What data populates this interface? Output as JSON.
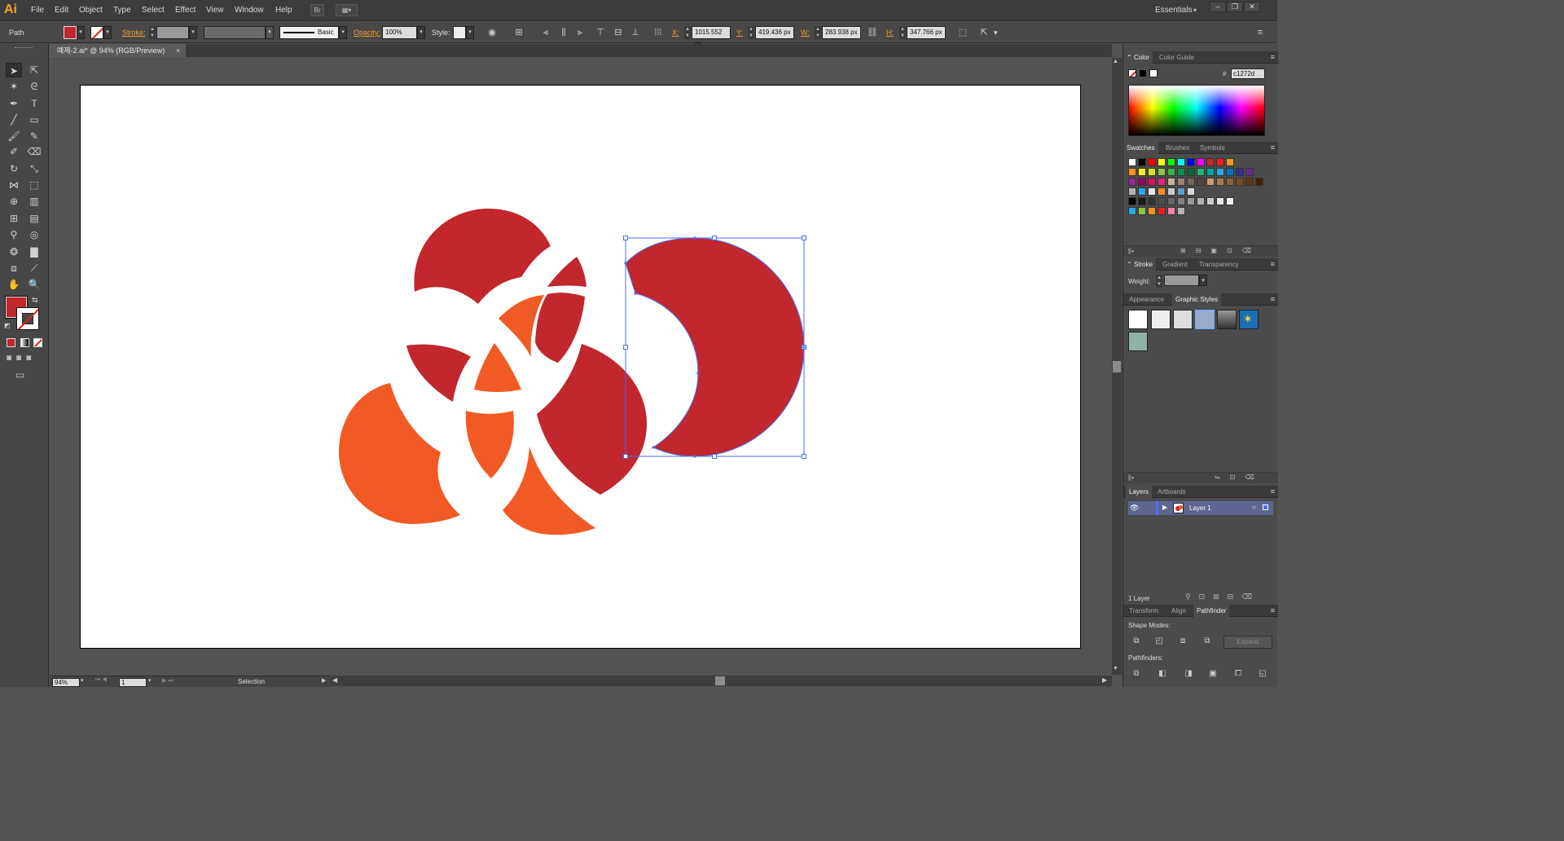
{
  "app": {
    "logo": "Ai"
  },
  "menu": [
    "File",
    "Edit",
    "Object",
    "Type",
    "Select",
    "Effect",
    "View",
    "Window",
    "Help"
  ],
  "menubar_buttons": {
    "bridge": "Br"
  },
  "workspace": "Essentials",
  "window_controls": {
    "minimize": "–",
    "restore": "❐",
    "close": "✕"
  },
  "control_bar": {
    "selection_type": "Path",
    "stroke_label": "Stroke:",
    "brush_style": "Basic",
    "opacity_label": "Opacity:",
    "opacity_value": "100%",
    "style_label": "Style:",
    "x_label": "X:",
    "x_value": "1015.552 px",
    "y_label": "Y:",
    "y_value": "419.436 px",
    "w_label": "W:",
    "w_value": "283.938 px",
    "h_label": "H:",
    "h_value": "347.766 px"
  },
  "document_tab": {
    "title": "예제-2.ai* @ 94% (RGB/Preview)",
    "close": "×"
  },
  "toolbar": {
    "tools": [
      "selection-tool",
      "direct-selection-tool",
      "magic-wand-tool",
      "lasso-tool",
      "pen-tool",
      "type-tool",
      "line-tool",
      "rectangle-tool",
      "paintbrush-tool",
      "pencil-tool",
      "blob-brush-tool",
      "eraser-tool",
      "rotate-tool",
      "scale-tool",
      "width-tool",
      "free-transform-tool",
      "shape-builder-tool",
      "perspective-grid-tool",
      "mesh-tool",
      "gradient-tool",
      "eyedropper-tool",
      "blend-tool",
      "symbol-sprayer-tool",
      "column-graph-tool",
      "artboard-tool",
      "slice-tool",
      "hand-tool",
      "zoom-tool"
    ],
    "fill_color": "#c1272d"
  },
  "artwork": {
    "colors": {
      "crimson": "#c1272d",
      "orange": "#f15a24"
    },
    "selection_color": "#4a6ef5"
  },
  "status_bar": {
    "zoom": "94%",
    "page": "1",
    "tool": "Selection"
  },
  "panels": {
    "color": {
      "tabs": [
        "Color",
        "Color Guide"
      ],
      "hex": "c1272d"
    },
    "swatches": {
      "tabs": [
        "Swatches",
        "Brushes",
        "Symbols"
      ],
      "rows": [
        [
          "#ffffff",
          "#000000",
          "#ff0000",
          "#ffff00",
          "#00ff00",
          "#00ffff",
          "#0000ff",
          "#ff00ff",
          "#c1272d",
          "#ed1c24",
          "#f7941d"
        ],
        [
          "#f7931e",
          "#fcee21",
          "#d9e021",
          "#8cc63f",
          "#39b54a",
          "#009245",
          "#006837",
          "#22b573",
          "#00a99d",
          "#29abe2",
          "#0071bc",
          "#2e3192",
          "#662d91"
        ],
        [
          "#93278f",
          "#9e005d",
          "#d4145a",
          "#ed1e79",
          "#c7b299",
          "#998675",
          "#736357",
          "#534741",
          "#c69c6d",
          "#a67c52",
          "#8c6239",
          "#754c24",
          "#603813",
          "#42210b"
        ],
        [
          "#b3b3b3",
          "#29abe2",
          "#e6e6e6",
          "#f7931e",
          "#cccccc",
          "#5b9bd5",
          "#d9d9d9"
        ],
        [
          "#000000",
          "#1a1a1a",
          "#333333",
          "#4d4d4d",
          "#666666",
          "#808080",
          "#999999",
          "#b3b3b3",
          "#cccccc",
          "#e6e6e6",
          "#f2f2f2"
        ],
        [
          "#29abe2",
          "#8cc63f",
          "#f7931e",
          "#ed1c24",
          "#ff7bac",
          "#b3b3b3"
        ]
      ]
    },
    "stroke": {
      "tabs": [
        "Stroke",
        "Gradient",
        "Transparency"
      ],
      "weight_label": "Weight:"
    },
    "appearance": {
      "tabs": [
        "Appearance",
        "Graphic Styles"
      ]
    },
    "layers": {
      "tabs": [
        "Layers",
        "Artboards"
      ],
      "layer_name": "Layer 1",
      "count": "1 Layer"
    },
    "pathfinder": {
      "tabs": [
        "Transform",
        "Align",
        "Pathfinder"
      ],
      "shape_modes_label": "Shape Modes:",
      "pathfinders_label": "Pathfinders:",
      "expand_label": "Expand"
    }
  }
}
